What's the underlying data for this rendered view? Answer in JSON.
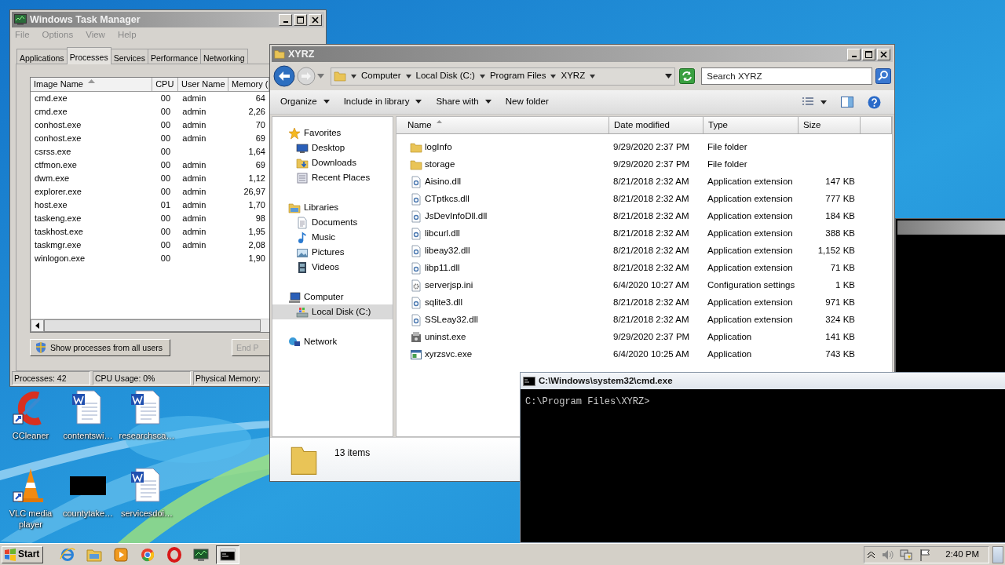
{
  "task_manager": {
    "title": "Windows Task Manager",
    "menu": [
      "File",
      "Options",
      "View",
      "Help"
    ],
    "tabs": [
      {
        "label": "Applications",
        "selected": false
      },
      {
        "label": "Processes",
        "selected": true
      },
      {
        "label": "Services",
        "selected": false
      },
      {
        "label": "Performance",
        "selected": false
      },
      {
        "label": "Networking",
        "selected": false
      }
    ],
    "columns": [
      {
        "label": "Image Name",
        "sorted": true
      },
      {
        "label": "CPU",
        "sorted": false
      },
      {
        "label": "User Name",
        "sorted": false
      },
      {
        "label": "Memory (",
        "sorted": false
      }
    ],
    "rows": [
      {
        "image": "cmd.exe",
        "cpu": "00",
        "user": "admin",
        "memory": "64"
      },
      {
        "image": "cmd.exe",
        "cpu": "00",
        "user": "admin",
        "memory": "2,26"
      },
      {
        "image": "conhost.exe",
        "cpu": "00",
        "user": "admin",
        "memory": "70"
      },
      {
        "image": "conhost.exe",
        "cpu": "00",
        "user": "admin",
        "memory": "69"
      },
      {
        "image": "csrss.exe",
        "cpu": "00",
        "memory": "1,64"
      },
      {
        "image": "ctfmon.exe",
        "cpu": "00",
        "user": "admin",
        "memory": "69"
      },
      {
        "image": "dwm.exe",
        "cpu": "00",
        "user": "admin",
        "memory": "1,12"
      },
      {
        "image": "explorer.exe",
        "cpu": "00",
        "user": "admin",
        "memory": "26,97"
      },
      {
        "image": "host.exe",
        "cpu": "01",
        "user": "admin",
        "memory": "1,70"
      },
      {
        "image": "taskeng.exe",
        "cpu": "00",
        "user": "admin",
        "memory": "98"
      },
      {
        "image": "taskhost.exe",
        "cpu": "00",
        "user": "admin",
        "memory": "1,95"
      },
      {
        "image": "taskmgr.exe",
        "cpu": "00",
        "user": "admin",
        "memory": "2,08"
      },
      {
        "image": "winlogon.exe",
        "cpu": "00",
        "memory": "1,90"
      }
    ],
    "show_all_button": "Show processes from all users",
    "end_button": {
      "label": "End P",
      "disabled": true
    },
    "status": [
      "Processes: 42",
      "CPU Usage: 0%",
      "Physical Memory:"
    ]
  },
  "explorer": {
    "title": "XYRZ",
    "breadcrumb": [
      "Computer",
      "Local Disk (C:)",
      "Program Files",
      "XYRZ"
    ],
    "search": {
      "placeholder": "Search XYRZ"
    },
    "toolbar": [
      {
        "label": "Organize",
        "dropdown": true
      },
      {
        "label": "Include in library",
        "dropdown": true
      },
      {
        "label": "Share with",
        "dropdown": true
      },
      {
        "label": "New folder",
        "dropdown": false
      }
    ],
    "nav": [
      {
        "label": "Favorites",
        "kind": "star",
        "selected": false,
        "children": [
          {
            "label": "Desktop",
            "kind": "desktop",
            "selected": false
          },
          {
            "label": "Downloads",
            "kind": "download",
            "selected": false
          },
          {
            "label": "Recent Places",
            "kind": "recent",
            "selected": false
          }
        ]
      },
      {
        "label": "Libraries",
        "kind": "library",
        "selected": false,
        "children": [
          {
            "label": "Documents",
            "kind": "document",
            "selected": false
          },
          {
            "label": "Music",
            "kind": "music",
            "selected": false
          },
          {
            "label": "Pictures",
            "kind": "pictures",
            "selected": false
          },
          {
            "label": "Videos",
            "kind": "videos",
            "selected": false
          }
        ]
      },
      {
        "label": "Computer",
        "kind": "computer",
        "selected": false,
        "children": [
          {
            "label": "Local Disk (C:)",
            "kind": "disk",
            "selected": true
          }
        ]
      },
      {
        "label": "Network",
        "kind": "network",
        "selected": false
      }
    ],
    "columns": [
      {
        "label": "Name",
        "sorted": true
      },
      {
        "label": "Date modified",
        "sorted": false
      },
      {
        "label": "Type",
        "sorted": false
      },
      {
        "label": "Size",
        "sorted": false
      }
    ],
    "files": [
      {
        "name": "logInfo",
        "date": "9/29/2020 2:37 PM",
        "type": "File folder",
        "kind": "folder"
      },
      {
        "name": "storage",
        "date": "9/29/2020 2:37 PM",
        "type": "File folder",
        "kind": "folder"
      },
      {
        "name": "Aisino.dll",
        "date": "8/21/2018 2:32 AM",
        "type": "Application extension",
        "size": "147 KB",
        "kind": "extension"
      },
      {
        "name": "CTptkcs.dll",
        "date": "8/21/2018 2:32 AM",
        "type": "Application extension",
        "size": "777 KB",
        "kind": "extension"
      },
      {
        "name": "JsDevInfoDll.dll",
        "date": "8/21/2018 2:32 AM",
        "type": "Application extension",
        "size": "184 KB",
        "kind": "extension"
      },
      {
        "name": "libcurl.dll",
        "date": "8/21/2018 2:32 AM",
        "type": "Application extension",
        "size": "388 KB",
        "kind": "extension"
      },
      {
        "name": "libeay32.dll",
        "date": "8/21/2018 2:32 AM",
        "type": "Application extension",
        "size": "1,152 KB",
        "kind": "extension"
      },
      {
        "name": "libp11.dll",
        "date": "8/21/2018 2:32 AM",
        "type": "Application extension",
        "size": "71 KB",
        "kind": "extension"
      },
      {
        "name": "serverjsp.ini",
        "date": "6/4/2020 10:27 AM",
        "type": "Configuration settings",
        "size": "1 KB",
        "kind": "settings"
      },
      {
        "name": "sqlite3.dll",
        "date": "8/21/2018 2:32 AM",
        "type": "Application extension",
        "size": "971 KB",
        "kind": "extension"
      },
      {
        "name": "SSLeay32.dll",
        "date": "8/21/2018 2:32 AM",
        "type": "Application extension",
        "size": "324 KB",
        "kind": "extension"
      },
      {
        "name": "uninst.exe",
        "date": "9/29/2020 2:37 PM",
        "type": "Application",
        "size": "141 KB",
        "kind": "installer"
      },
      {
        "name": "xyrzsvc.exe",
        "date": "6/4/2020 10:25 AM",
        "type": "Application",
        "size": "743 KB",
        "kind": "app"
      }
    ],
    "status": "13 items"
  },
  "cmd": {
    "title": "C:\\Windows\\system32\\cmd.exe",
    "lines": [
      "C:\\Program Files\\XYRZ>"
    ]
  },
  "desktop_icons": [
    {
      "label": "CCleaner",
      "kind": "cleaner"
    },
    {
      "label": "contentswi…",
      "kind": "word"
    },
    {
      "label": "researchsca…",
      "kind": "word"
    },
    {
      "label": "VLC media player",
      "kind": "cone"
    },
    {
      "label": "countytake…",
      "kind": "thumbnail"
    },
    {
      "label": "servicesdoi…",
      "kind": "word"
    }
  ],
  "taskbar": {
    "start": "Start",
    "apps": [
      {
        "kind": "browser",
        "selected": false
      },
      {
        "kind": "folder",
        "selected": false
      },
      {
        "kind": "media",
        "selected": false
      },
      {
        "kind": "chrome",
        "selected": false
      },
      {
        "kind": "ring",
        "selected": false
      },
      {
        "kind": "taskmgr",
        "selected": false
      },
      {
        "kind": "console",
        "selected": true
      }
    ],
    "clock": "2:40 PM"
  }
}
